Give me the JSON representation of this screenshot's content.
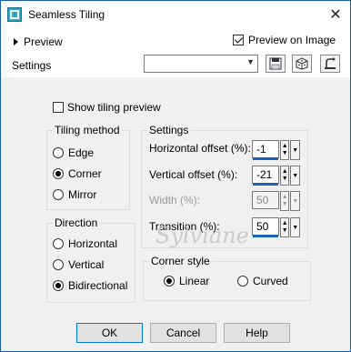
{
  "window": {
    "title": "Seamless Tiling"
  },
  "toolbar": {
    "preview_label": "Preview",
    "preview_on_image_label": "Preview on Image",
    "settings_label": "Settings",
    "settings_value": ""
  },
  "main": {
    "show_tiling_preview_label": "Show tiling preview",
    "tiling_method": {
      "title": "Tiling method",
      "options": [
        "Edge",
        "Corner",
        "Mirror"
      ],
      "selected": "Corner"
    },
    "direction": {
      "title": "Direction",
      "options": [
        "Horizontal",
        "Vertical",
        "Bidirectional"
      ],
      "selected": "Bidirectional"
    },
    "settings": {
      "title": "Settings",
      "fields": [
        {
          "label": "Horizontal offset (%):",
          "value": "-1"
        },
        {
          "label": "Vertical offset (%):",
          "value": "-21"
        },
        {
          "label": "Width (%):",
          "value": "50"
        },
        {
          "label": "Transition (%):",
          "value": "50"
        }
      ]
    },
    "corner_style": {
      "title": "Corner style",
      "options": [
        "Linear",
        "Curved"
      ],
      "selected": "Linear"
    },
    "watermark": "Sylviane"
  },
  "buttons": {
    "ok": "OK",
    "cancel": "Cancel",
    "help": "Help"
  }
}
